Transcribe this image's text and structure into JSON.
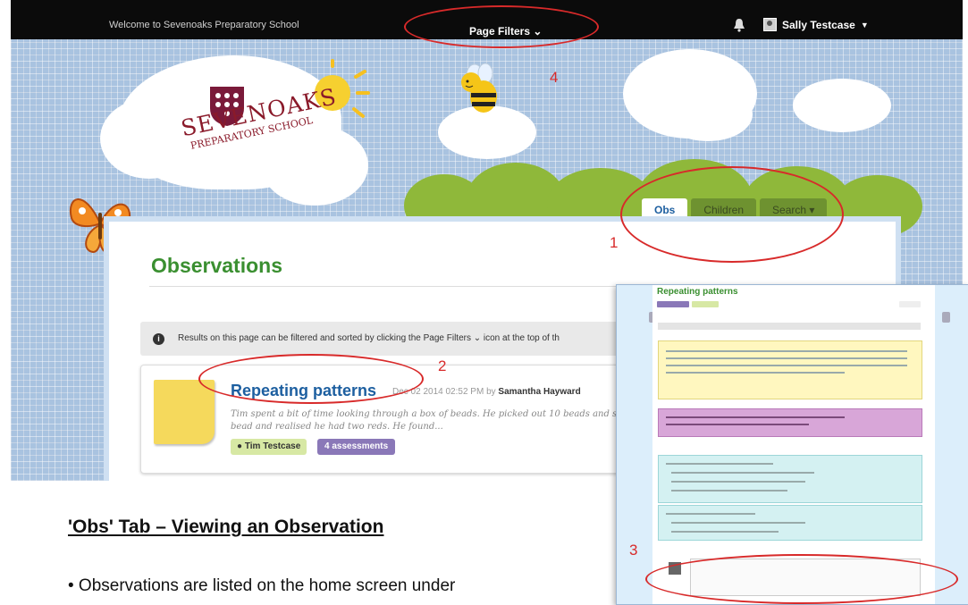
{
  "header": {
    "welcome": "Welcome to Sevenoaks Preparatory School",
    "filters_label": "Page Filters ⌄",
    "user_name": "Sally Testcase"
  },
  "branding": {
    "school_name_line1": "SEVENOAKS",
    "school_name_line2": "PREPARATORY SCHOOL"
  },
  "tabs": [
    {
      "label": "Obs",
      "active": true
    },
    {
      "label": "Children",
      "active": false
    },
    {
      "label": "Search ▾",
      "active": false
    }
  ],
  "main": {
    "title": "Observations",
    "info_text": "Results on this page can be filtered and sorted by clicking the Page Filters ⌄ icon at the top of th",
    "card": {
      "title": "Repeating patterns",
      "date": "Dec 02 2014 02:52 PM by",
      "author": "Samantha Hayward",
      "excerpt": "Tim spent a bit of time looking through a box of beads. He picked out 10 beads and s He reached the 8th bead and realised he had two reds. He found...",
      "child_tag": "Tim Testcase",
      "assessments_tag": "4 assessments"
    }
  },
  "annotations": {
    "n1": "1",
    "n2": "2",
    "n3": "3",
    "n4": "4"
  },
  "inset": {
    "title": "Repeating patterns"
  },
  "document": {
    "section_title": "'Obs' Tab – Viewing an Observation",
    "bullet": "• Observations are listed on the home screen under"
  },
  "colors": {
    "accent_green": "#3a8f30",
    "link_blue": "#1d5fa0",
    "annotation_red": "#d82a2a",
    "assessment_purple": "#8a78b8"
  }
}
